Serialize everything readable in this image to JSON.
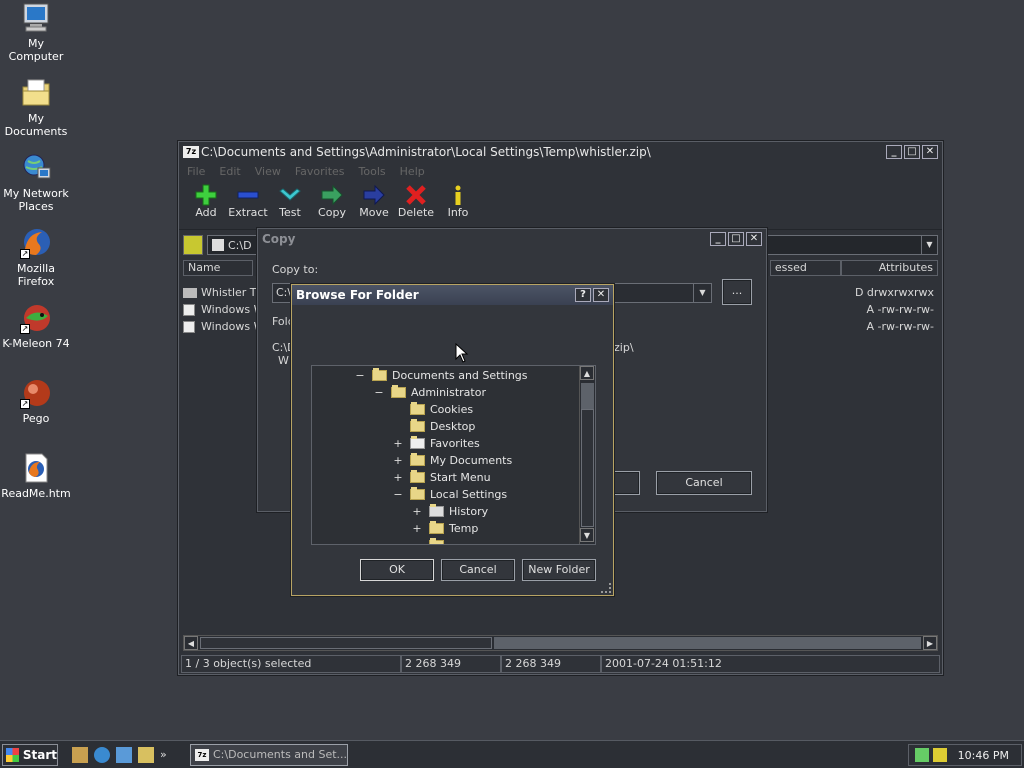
{
  "desktop": {
    "icons": [
      {
        "label": "My Computer"
      },
      {
        "label": "My Documents"
      },
      {
        "label": "My Network Places"
      },
      {
        "label": "Mozilla Firefox"
      },
      {
        "label": "K-Meleon 74"
      },
      {
        "label": "Pego"
      },
      {
        "label": "ReadMe.htm"
      }
    ]
  },
  "main_window": {
    "title": "C:\\Documents and Settings\\Administrator\\Local Settings\\Temp\\whistler.zip\\",
    "app_badge": "7z",
    "menu": [
      "File",
      "Edit",
      "View",
      "Favorites",
      "Tools",
      "Help"
    ],
    "toolbar": [
      {
        "label": "Add",
        "icon": "add-icon",
        "color": "#3ecf3e"
      },
      {
        "label": "Extract",
        "icon": "extract-icon",
        "color": "#2a4fd0"
      },
      {
        "label": "Test",
        "icon": "test-icon",
        "color": "#3ec8d0"
      },
      {
        "label": "Copy",
        "icon": "copy-icon",
        "color": "#3aa060"
      },
      {
        "label": "Move",
        "icon": "move-icon",
        "color": "#2a3ea0"
      },
      {
        "label": "Delete",
        "icon": "delete-icon",
        "color": "#e02020"
      },
      {
        "label": "Info",
        "icon": "info-icon",
        "color": "#e8d020"
      }
    ],
    "address": "C:\\D",
    "columns": {
      "name": "Name",
      "accessed": "essed",
      "attributes": "Attributes"
    },
    "rows": [
      {
        "name": "Whistler Th",
        "attributes": "D drwxrwxrwx"
      },
      {
        "name": "Windows W",
        "attributes": "A -rw-rw-rw-"
      },
      {
        "name": "Windows W",
        "attributes": "A -rw-rw-rw-"
      }
    ],
    "status": {
      "selected": "1 / 3 object(s) selected",
      "size": "2 268 349",
      "packed": "2 268 349",
      "modified": "2001-07-24 01:51:12"
    }
  },
  "copy_dialog": {
    "title": "Copy",
    "copy_to_label": "Copy to:",
    "path_value": "C:\\",
    "browse_button": "...",
    "folder_label": "Fold",
    "info_line1_left": "C:\\D",
    "info_line1_right": "zip\\",
    "info_line2": "W",
    "cancel": "Cancel"
  },
  "browse_dialog": {
    "title": "Browse For Folder",
    "help": "?",
    "tree": [
      {
        "label": "Documents and Settings",
        "toggle": "−",
        "special": false
      },
      {
        "label": "Administrator",
        "toggle": "−",
        "special": false
      },
      {
        "label": "Cookies",
        "toggle": "",
        "special": false
      },
      {
        "label": "Desktop",
        "toggle": "",
        "special": false
      },
      {
        "label": "Favorites",
        "toggle": "+",
        "special": true
      },
      {
        "label": "My Documents",
        "toggle": "+",
        "special": false
      },
      {
        "label": "Start Menu",
        "toggle": "+",
        "special": false
      },
      {
        "label": "Local Settings",
        "toggle": "−",
        "special": false
      },
      {
        "label": "History",
        "toggle": "+",
        "special": true
      },
      {
        "label": "Temp",
        "toggle": "+",
        "special": false
      }
    ],
    "ok": "OK",
    "cancel": "Cancel",
    "new_folder": "New Folder"
  },
  "taskbar": {
    "start": "Start",
    "task": "C:\\Documents and Set...",
    "clock": "10:46 PM"
  }
}
